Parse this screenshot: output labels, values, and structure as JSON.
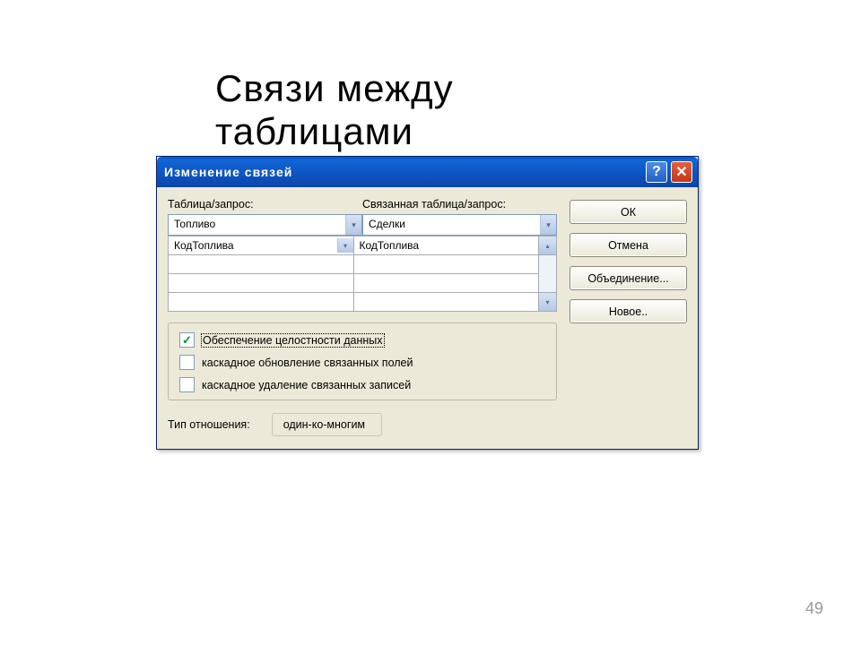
{
  "slide": {
    "title": "Связи между таблицами",
    "page_number": "49"
  },
  "dialog": {
    "title": "Изменение связей",
    "labels": {
      "table_query": "Таблица/запрос:",
      "related_table_query": "Связанная таблица/запрос:",
      "relationship_type": "Тип отношения:"
    },
    "left_table": "Топливо",
    "right_table": "Сделки",
    "left_field": "КодТоплива",
    "right_field": "КодТоплива",
    "checkboxes": {
      "integrity": {
        "label": "Обеспечение целостности данных",
        "checked": true
      },
      "cascade_update": {
        "label": "каскадное обновление связанных полей",
        "checked": false
      },
      "cascade_delete": {
        "label": "каскадное удаление связанных записей",
        "checked": false
      }
    },
    "relationship_value": "один-ко-многим",
    "buttons": {
      "ok": "ОК",
      "cancel": "Отмена",
      "join": "Объединение...",
      "new": "Новое.."
    }
  }
}
